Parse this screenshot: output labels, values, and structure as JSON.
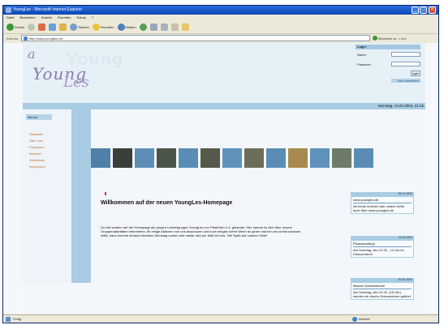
{
  "window": {
    "title": "YoungLes - Microsoft Internet Explorer",
    "controls": [
      "_",
      "□",
      "×"
    ]
  },
  "menubar": [
    "Datei",
    "Bearbeiten",
    "Ansicht",
    "Favoriten",
    "Extras",
    "?"
  ],
  "toolbar": {
    "back_label": "Zurück",
    "search_label": "Suchen",
    "favorites_label": "Favoriten",
    "media_label": "Medien"
  },
  "addressbar": {
    "label": "Adresse",
    "url": "http://www.youngles.de/",
    "go_label": "Wechseln zu",
    "links_label": "Links"
  },
  "page": {
    "logo": {
      "letter": "a",
      "main": "Young",
      "sub": "Les",
      "ghost": "Young"
    },
    "login": {
      "title": "Login",
      "name_label": "Name:",
      "password_label": "Passwort:",
      "button_label": "login",
      "register_label": "Neu anmelden"
    },
    "date": "Samstag, 14.02.2004, 21:15",
    "sidebar": {
      "title": "Menue",
      "items": [
        "Startseite",
        "Über Uns",
        "Programm",
        "Berichte",
        "Gästebuch",
        "Impressum"
      ]
    },
    "welcome": "Willkommen auf der neuen YoungLes-Homepage",
    "intro": "Du bist soeben auf der Homepage der jungen Lesbengruppe YoungLes von Pfaderlich e.V. gelandet. Hier kannst du dich über unsere Gruppenaktivitäten informieren, dir einige Aktionen von uns anschauen und noch einiges mehr! Wenn du gerne mal bei uns vorbei schauen willst, dann komme einfach nächsten Dienstag vorbei oder melde dich per Mail bei uns. Viel Spaß auf unserer Seite!",
    "news": [
      {
        "date": "15.01.2004",
        "text": "www.youngles.de",
        "text2": "Ab heute erreicht man unsere Seite auch über www.youngles.de"
      },
      {
        "date": "11.02.2004",
        "text": "Photoshooting!",
        "text2": "Am Sonntag, den 22.02., 13 Uhr im Dokuzentrum"
      },
      {
        "date": "10.02.2004",
        "text": "Besuch Dokuzentrum!",
        "text2": "Am Sonntag, den 22.02. (15 Uhr) werden wir durchs Dokuzentrum geführt"
      }
    ]
  },
  "statusbar": {
    "text": "Fertig",
    "zone": "Internet"
  },
  "colors": {
    "accent": "#a8cce3",
    "link": "#c36c2b",
    "title_bar": "#0c48b8"
  }
}
